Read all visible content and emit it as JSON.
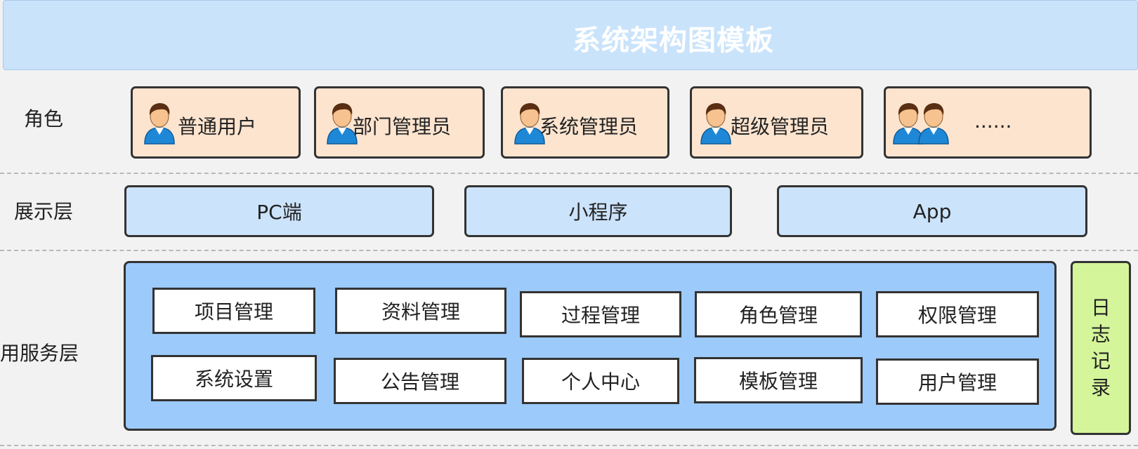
{
  "title": "系统架构图模板",
  "layers": {
    "role": "角色",
    "presentation": "展示层",
    "service": "应用服务层"
  },
  "roles": [
    {
      "label": "普通用户"
    },
    {
      "label": "部门管理员"
    },
    {
      "label": "系统管理员"
    },
    {
      "label": "超级管理员"
    },
    {
      "label": "......"
    }
  ],
  "presentation": [
    "PC端",
    "小程序",
    "App"
  ],
  "services": [
    "项目管理",
    "资料管理",
    "过程管理",
    "角色管理",
    "权限管理",
    "系统设置",
    "公告管理",
    "个人中心",
    "模板管理",
    "用户管理"
  ],
  "log": [
    "日",
    "志",
    "记",
    "录"
  ],
  "colors": {
    "title_bg": "#c9e3fb",
    "role_bg": "#fde4cf",
    "presentation_bg": "#cbe3fb",
    "service_panel_bg": "#9ccafa",
    "log_bg": "#d4f59a"
  }
}
